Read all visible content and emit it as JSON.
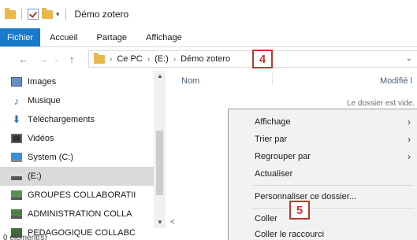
{
  "window": {
    "title": "Démo zotero"
  },
  "ribbon": {
    "tabs": [
      "Fichier",
      "Accueil",
      "Partage",
      "Affichage"
    ]
  },
  "address": {
    "segments": [
      "Ce PC",
      "(E:)",
      "Démo zotero"
    ],
    "dropdown": "⌄"
  },
  "annotations": {
    "step4": "4",
    "step5": "5"
  },
  "sidebar": {
    "items": [
      {
        "label": "Images",
        "icon": "images-icon"
      },
      {
        "label": "Musique",
        "icon": "music-icon"
      },
      {
        "label": "Téléchargements",
        "icon": "downloads-icon"
      },
      {
        "label": "Vidéos",
        "icon": "videos-icon"
      },
      {
        "label": "System (C:)",
        "icon": "system-drive-icon"
      },
      {
        "label": "(E:)",
        "icon": "drive-icon",
        "selected": true
      },
      {
        "label": "GROUPES COLLABORATII",
        "icon": "network-drive-icon"
      },
      {
        "label": "ADMINISTRATION COLLA",
        "icon": "network-drive-icon"
      },
      {
        "label": "PEDAGOGIQUE COLLABC",
        "icon": "network-drive-icon"
      }
    ]
  },
  "content": {
    "columns": [
      "Nom",
      "Modifié l"
    ],
    "empty_message": "Le dossier est vide."
  },
  "status": {
    "text": "0 élément(s)"
  },
  "context_menu": {
    "items": [
      {
        "label": "Affichage",
        "submenu": true
      },
      {
        "label": "Trier par",
        "submenu": true
      },
      {
        "label": "Regrouper par",
        "submenu": true
      },
      {
        "label": "Actualiser",
        "submenu": false
      },
      {
        "label": "Personnaliser ce dossier...",
        "submenu": false
      },
      {
        "label": "Coller",
        "submenu": false
      },
      {
        "label": "Coller le raccourci",
        "submenu": false
      }
    ]
  },
  "colors": {
    "accent": "#1979ca",
    "annotation": "#c0392b",
    "folder": "#e8b84a"
  }
}
